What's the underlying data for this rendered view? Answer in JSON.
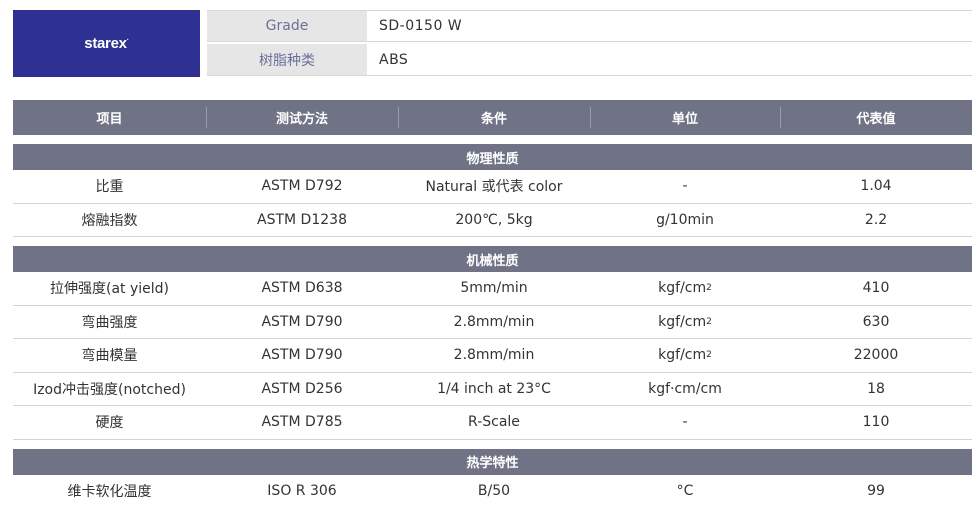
{
  "brand": {
    "logo_text": "starex",
    "logo_mark": "·",
    "bg_color": "#2e3192"
  },
  "info": {
    "grade_label": "Grade",
    "grade_value": "SD-0150 W",
    "resin_label": "树脂种类",
    "resin_value": "ABS"
  },
  "header": {
    "col_item": "项目",
    "col_method": "测试方法",
    "col_condition": "条件",
    "col_unit": "单位",
    "col_value": "代表值"
  },
  "sections": {
    "physical": {
      "title": "物理性质",
      "rows": [
        {
          "item": "比重",
          "method": "ASTM D792",
          "condition": "Natural 或代表 color",
          "unit": "-",
          "value": "1.04"
        },
        {
          "item": "熔融指数",
          "method": "ASTM D1238",
          "condition": "200℃, 5kg",
          "unit": "g/10min",
          "value": "2.2"
        }
      ]
    },
    "mechanical": {
      "title": "机械性质",
      "rows": [
        {
          "item": "拉伸强度(at yield)",
          "method": "ASTM D638",
          "condition": "5mm/min",
          "unit": "kgf/cm",
          "unit_sup": "2",
          "value": "410"
        },
        {
          "item": "弯曲强度",
          "method": "ASTM D790",
          "condition": "2.8mm/min",
          "unit": "kgf/cm",
          "unit_sup": "2",
          "value": "630"
        },
        {
          "item": "弯曲模量",
          "method": "ASTM D790",
          "condition": "2.8mm/min",
          "unit": "kgf/cm",
          "unit_sup": "2",
          "value": "22000"
        },
        {
          "item": "Izod冲击强度(notched)",
          "method": "ASTM D256",
          "condition": "1/4 inch at 23°C",
          "unit": "kgf·cm/cm",
          "value": "18"
        },
        {
          "item": "硬度",
          "method": "ASTM D785",
          "condition": "R-Scale",
          "unit": "-",
          "value": "110"
        }
      ]
    },
    "thermal": {
      "title": "热学特性",
      "rows": [
        {
          "item": "维卡软化温度",
          "method": "ISO R 306",
          "condition": "B/50",
          "unit": "°C",
          "value": "99"
        }
      ]
    }
  }
}
